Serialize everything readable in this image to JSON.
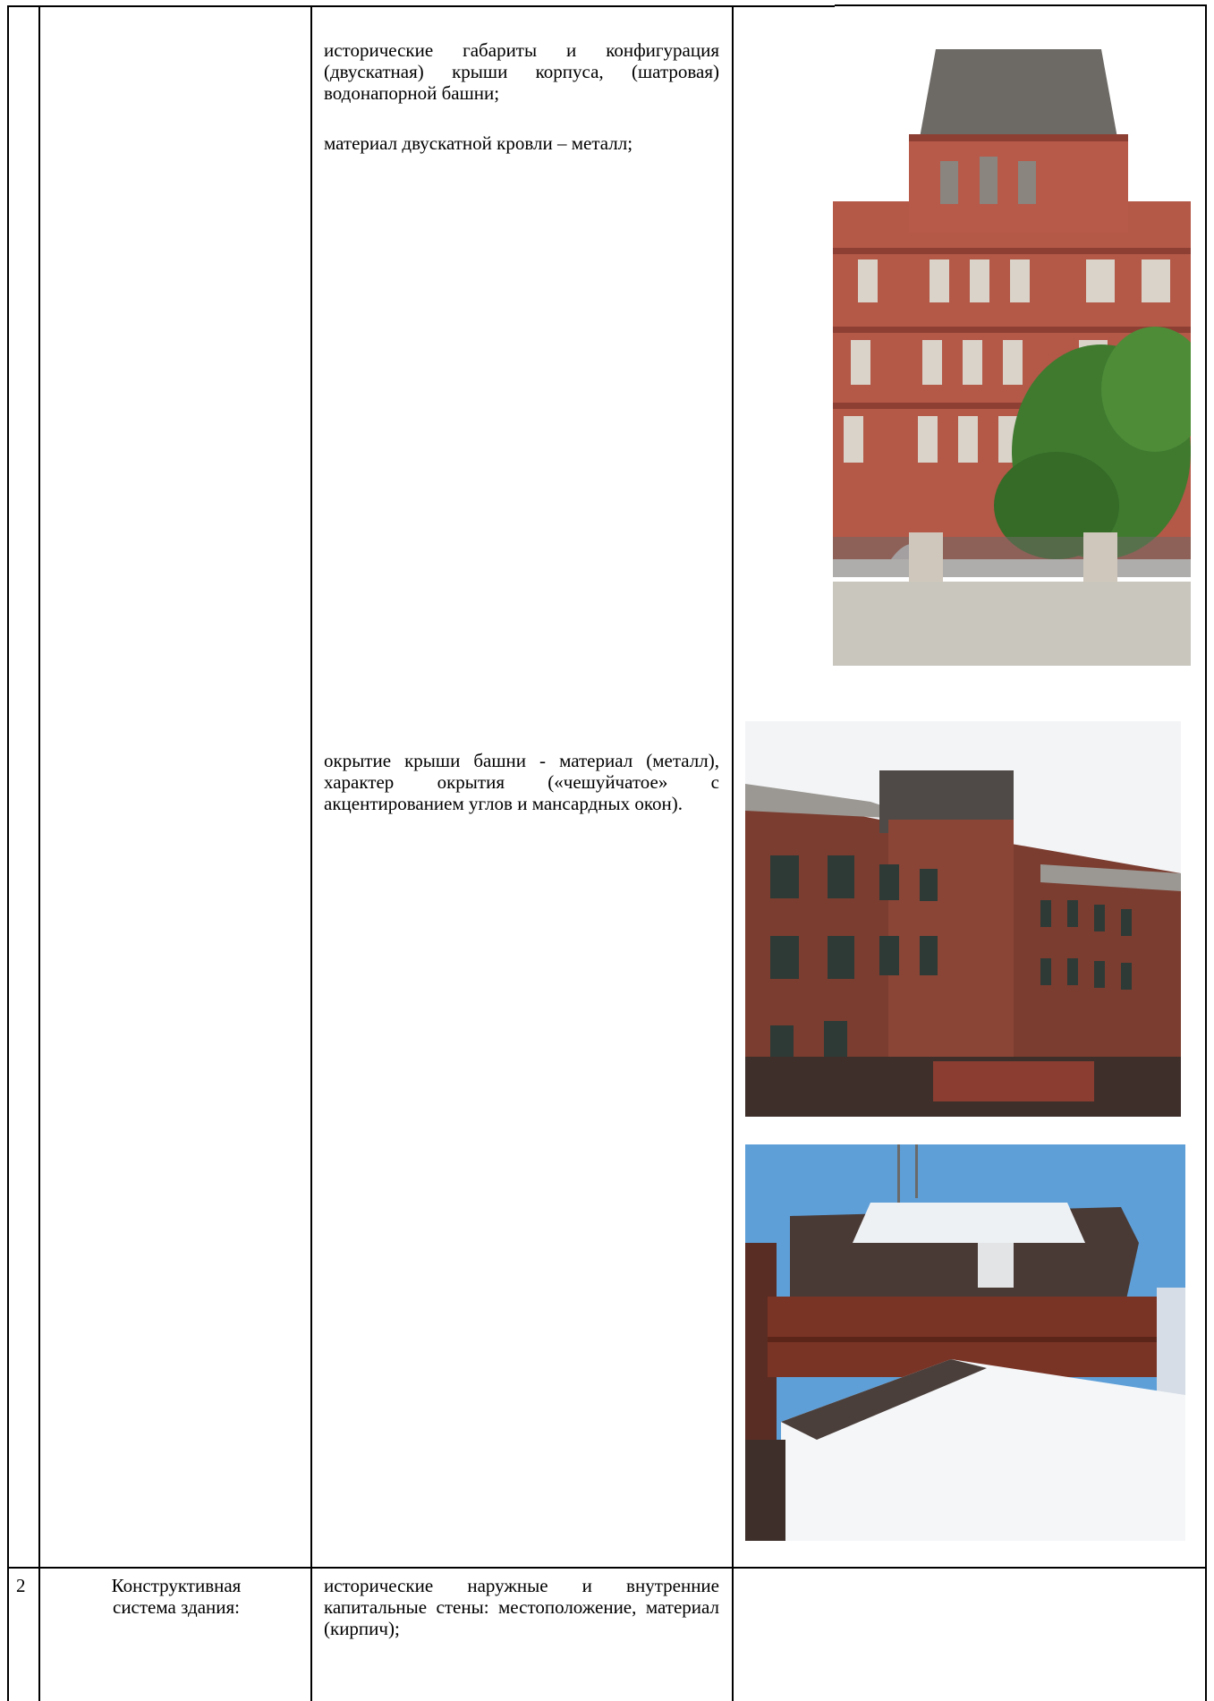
{
  "row1": {
    "number": "",
    "name": "",
    "description": {
      "p1": "исторические габариты и конфигурация (двускатная) крыши корпуса, (шатровая) водонапорной башни;",
      "p2": "материал двускатной кровли – металл;",
      "p3": "окрытие крыши башни - материал (металл), характер окрытия («чешуйчатое» с акцентированием углов и мансардных окон)."
    },
    "photos": [
      {
        "icon": "tower-facade-photo"
      },
      {
        "icon": "courtyard-building-photo"
      },
      {
        "icon": "snowy-roof-photo"
      }
    ]
  },
  "row2": {
    "number": "2",
    "name": "Конструктивная система здания:",
    "description": "исторические наружные и внутренние капитальные стены: местоположение, материал (кирпич);"
  },
  "colors": {
    "brick": "#b85a4c",
    "dark_brick": "#6b3028",
    "sky": "#5e9fd8",
    "tree": "#3f7a2f",
    "snow": "#f4f6f8"
  }
}
